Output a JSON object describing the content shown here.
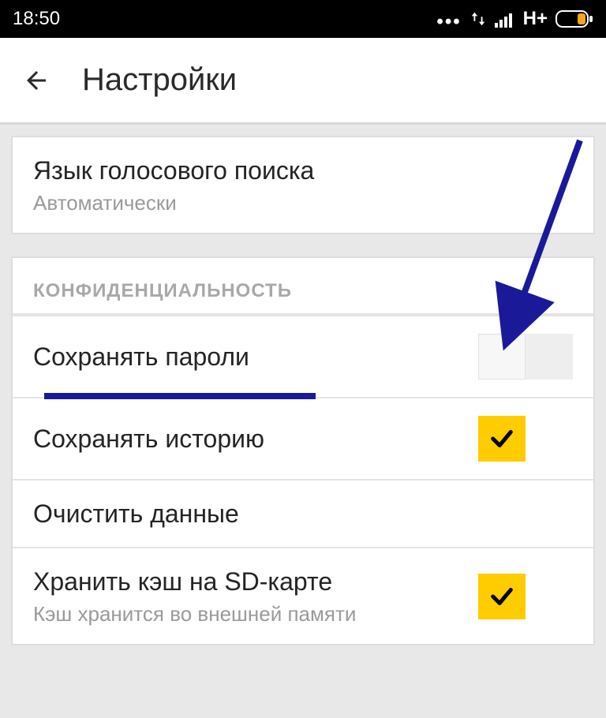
{
  "status": {
    "time": "18:50",
    "network_label": "H+"
  },
  "header": {
    "title": "Настройки"
  },
  "voice_search": {
    "title": "Язык голосового поиска",
    "value": "Автоматически"
  },
  "privacy": {
    "section_title": "КОНФИДЕНЦИАЛЬНОСТЬ",
    "save_passwords": {
      "label": "Сохранять пароли",
      "enabled": false
    },
    "save_history": {
      "label": "Сохранять историю",
      "enabled": true
    },
    "clear_data": {
      "label": "Очистить данные"
    },
    "cache_sd": {
      "label": "Хранить кэш на SD-карте",
      "sub": "Кэш хранится во внешней памяти",
      "enabled": true
    }
  },
  "annotation": {
    "underline_target": "save_passwords",
    "arrow_target": "save_passwords_toggle",
    "color": "#1a1a99"
  }
}
